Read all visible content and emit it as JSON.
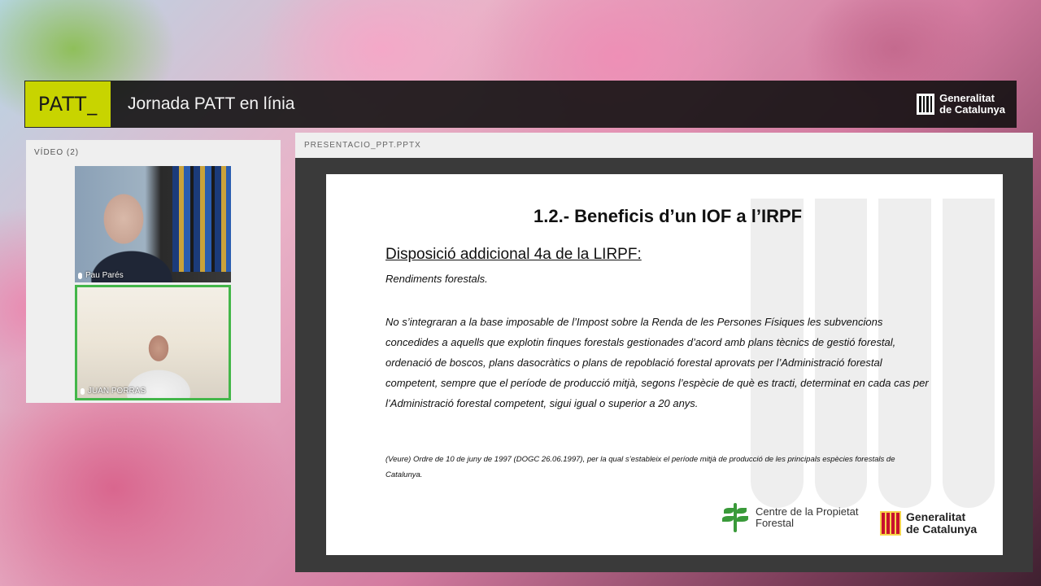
{
  "header": {
    "logo_text": "PATT_",
    "title": "Jornada PATT en línia",
    "brand_line1": "Generalitat",
    "brand_line2": "de Catalunya"
  },
  "video_panel": {
    "title": "VÍDEO (2)",
    "participants": [
      {
        "name": "Pau Parés",
        "active_speaker": false
      },
      {
        "name": "JUAN PORRAS",
        "active_speaker": true
      }
    ]
  },
  "presentation": {
    "file_name": "PRESENTACIO_PPT.PPTX",
    "slide": {
      "title": "1.2.- Beneficis d’un IOF a l’IRPF",
      "subtitle": "Disposició addicional 4a de la LIRPF:",
      "subhead": "Rendiments forestals.",
      "body": "No s’integraran a la base imposable de l’Impost sobre la Renda de les Persones Físiques les subvencions concedides a aquells que explotin finques forestals gestionades d’acord amb plans tècnics de gestió forestal, ordenació de boscos, plans dasocràtics o plans de repoblació forestal aprovats per l’Administració forestal competent, sempre que el període de producció mitjà, segons l’espècie de què es tracti, determinat en cada cas per l’Administració forestal competent, sigui igual o superior a 20 anys.",
      "note": "(Veure) Ordre de 10 de juny de 1997 (DOGC 26.06.1997), per la qual s’estableix el període mitjà de producció de les principals espècies forestals de Catalunya.",
      "logo_cpf_line1": "Centre de la Propietat",
      "logo_cpf_line2": "Forestal",
      "logo_gen_line1": "Generalitat",
      "logo_gen_line2": "de Catalunya"
    }
  },
  "colors": {
    "patt_lime": "#c8d400",
    "active_speaker_border": "#43b649"
  }
}
